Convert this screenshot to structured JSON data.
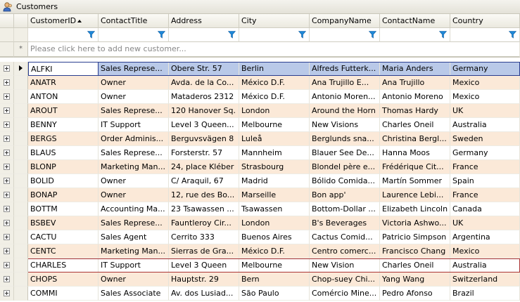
{
  "window": {
    "title": "Customers",
    "icon": "users-icon"
  },
  "columns": [
    "CustomerID",
    "ContactTitle",
    "Address",
    "City",
    "CompanyName",
    "ContactName",
    "Country"
  ],
  "new_row": {
    "placeholder": "Please click here to add new customer...",
    "marker": "*"
  },
  "colors": {
    "alt_row": "#fbe9d8",
    "selected_row": "#b9c9e8",
    "header": "#ebe9df",
    "filter_icon": "#1e88d8"
  },
  "rows": [
    [
      "ALFKI",
      "Sales Represe...",
      "Obere Str. 57",
      "Berlin",
      "Alfreds Futterk...",
      "Maria Anders",
      "Germany"
    ],
    [
      "ANATR",
      "Owner",
      "Avda. de la Co...",
      "México D.F.",
      "Ana Trujillo E...",
      "Ana Trujillo",
      "Mexico"
    ],
    [
      "ANTON",
      "Owner",
      "Mataderos 2312",
      "México D.F.",
      "Antonio Moren...",
      "Antonio Moreno",
      "Mexico"
    ],
    [
      "AROUT",
      "Sales Represe...",
      "120 Hanover Sq.",
      "London",
      "Around the Horn",
      "Thomas Hardy",
      "UK"
    ],
    [
      "BENNY",
      "IT Support",
      "Level 3 Queen...",
      "Melbourne",
      "New Visions",
      "Charles Oneil",
      "Australia"
    ],
    [
      "BERGS",
      "Order Adminis...",
      "Berguvsvägen 8",
      "Luleå",
      "Berglunds sna...",
      "Christina Bergl...",
      "Sweden"
    ],
    [
      "BLAUS",
      "Sales Represe...",
      "Forsterstr. 57",
      "Mannheim",
      "Blauer See De...",
      "Hanna Moos",
      "Germany"
    ],
    [
      "BLONP",
      "Marketing Man...",
      "24, place Kléber",
      "Strasbourg",
      "Blondel père e...",
      "Frédérique Cit...",
      "France"
    ],
    [
      "BOLID",
      "Owner",
      "C/ Araquil, 67",
      "Madrid",
      "Bólido Comida...",
      "Martín Sommer",
      "Spain"
    ],
    [
      "BONAP",
      "Owner",
      "12, rue des Bo...",
      "Marseille",
      "Bon app'",
      "Laurence Lebi...",
      "France"
    ],
    [
      "BOTTM",
      "Accounting Ma...",
      "23 Tsawassen ...",
      "Tsawassen",
      "Bottom-Dollar ...",
      "Elizabeth Lincoln",
      "Canada"
    ],
    [
      "BSBEV",
      "Sales Represe...",
      "Fauntleroy Cir...",
      "London",
      "B's Beverages",
      "Victoria Ashwo...",
      "UK"
    ],
    [
      "CACTU",
      "Sales Agent",
      "Cerrito 333",
      "Buenos Aires",
      "Cactus Comid...",
      "Patricio Simpson",
      "Argentina"
    ],
    [
      "CENTC",
      "Marketing Man...",
      "Sierras de Gra...",
      "México D.F.",
      "Centro comerc...",
      "Francisco Chang",
      "Mexico"
    ],
    [
      "CHARLES",
      "IT Support",
      "Level 3 Queen",
      "Melbourne",
      "New Vision",
      "Charles Oneil",
      "Australia"
    ],
    [
      "CHOPS",
      "Owner",
      "Hauptstr. 29",
      "Bern",
      "Chop-suey Chi...",
      "Yang Wang",
      "Switzerland"
    ],
    [
      "COMMI",
      "Sales Associate",
      "Av. dos Lusiad...",
      "São Paulo",
      "Comércio Mine...",
      "Pedro Afonso",
      "Brazil"
    ]
  ]
}
